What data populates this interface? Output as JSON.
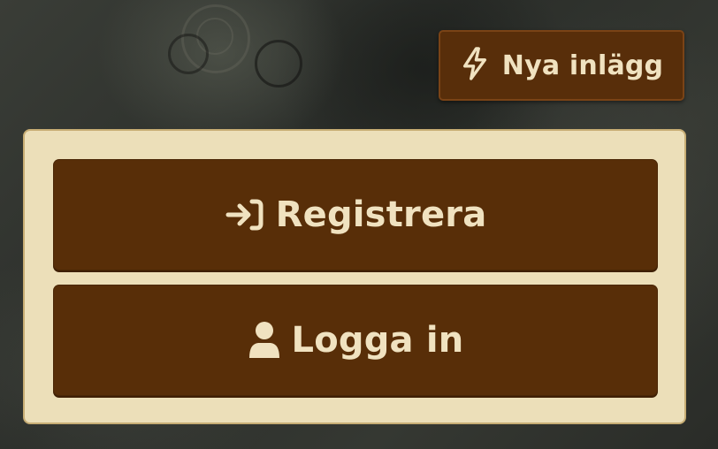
{
  "header": {
    "new_posts": {
      "label": "Nya inlägg",
      "icon": "lightning-icon"
    }
  },
  "auth_panel": {
    "register": {
      "label": "Registrera",
      "icon": "sign-in-arrow-icon"
    },
    "login": {
      "label": "Logga in",
      "icon": "user-icon"
    }
  },
  "colors": {
    "button_bg": "#582e08",
    "button_text": "#f0e2c0",
    "panel_bg": "#ecdfb9",
    "panel_border": "#c7ad74"
  }
}
